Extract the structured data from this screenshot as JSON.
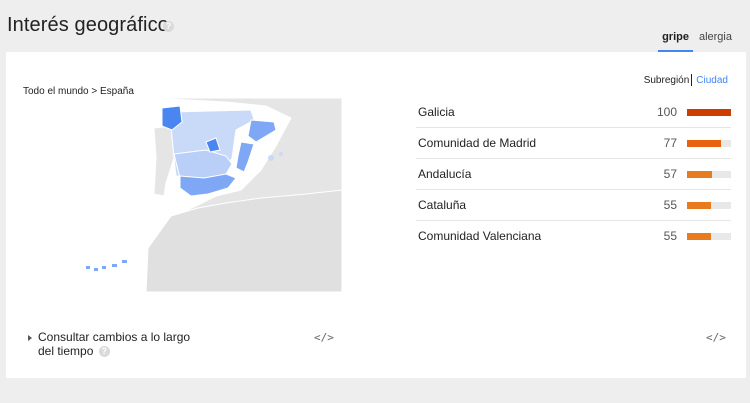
{
  "header": {
    "title": "Interés geográfico",
    "help": "?"
  },
  "tabs": [
    {
      "label": "gripe",
      "active": true
    },
    {
      "label": "alergia",
      "active": false
    }
  ],
  "breadcrumb": "Todo el mundo > España",
  "toggle": {
    "subregion": "Subregión",
    "city": "Ciudad"
  },
  "regions": [
    {
      "name": "Galicia",
      "value": 100,
      "color": "#cc3d00"
    },
    {
      "name": "Comunidad de Madrid",
      "value": 77,
      "color": "#e8620e"
    },
    {
      "name": "Andalucía",
      "value": 57,
      "color": "#e97b1f"
    },
    {
      "name": "Cataluña",
      "value": 55,
      "color": "#e97b1f"
    },
    {
      "name": "Comunidad Valenciana",
      "value": 55,
      "color": "#e97b1f"
    }
  ],
  "consult": {
    "line1": "Consultar cambios a lo largo",
    "line2": "del tiempo",
    "help": "?"
  },
  "embed_left": "</>",
  "embed_right": "</>",
  "colors": {
    "accent": "#4285f4",
    "map_dark": "#4a86f0",
    "map_mid": "#7ea8f5",
    "map_light": "#c9daf8"
  }
}
